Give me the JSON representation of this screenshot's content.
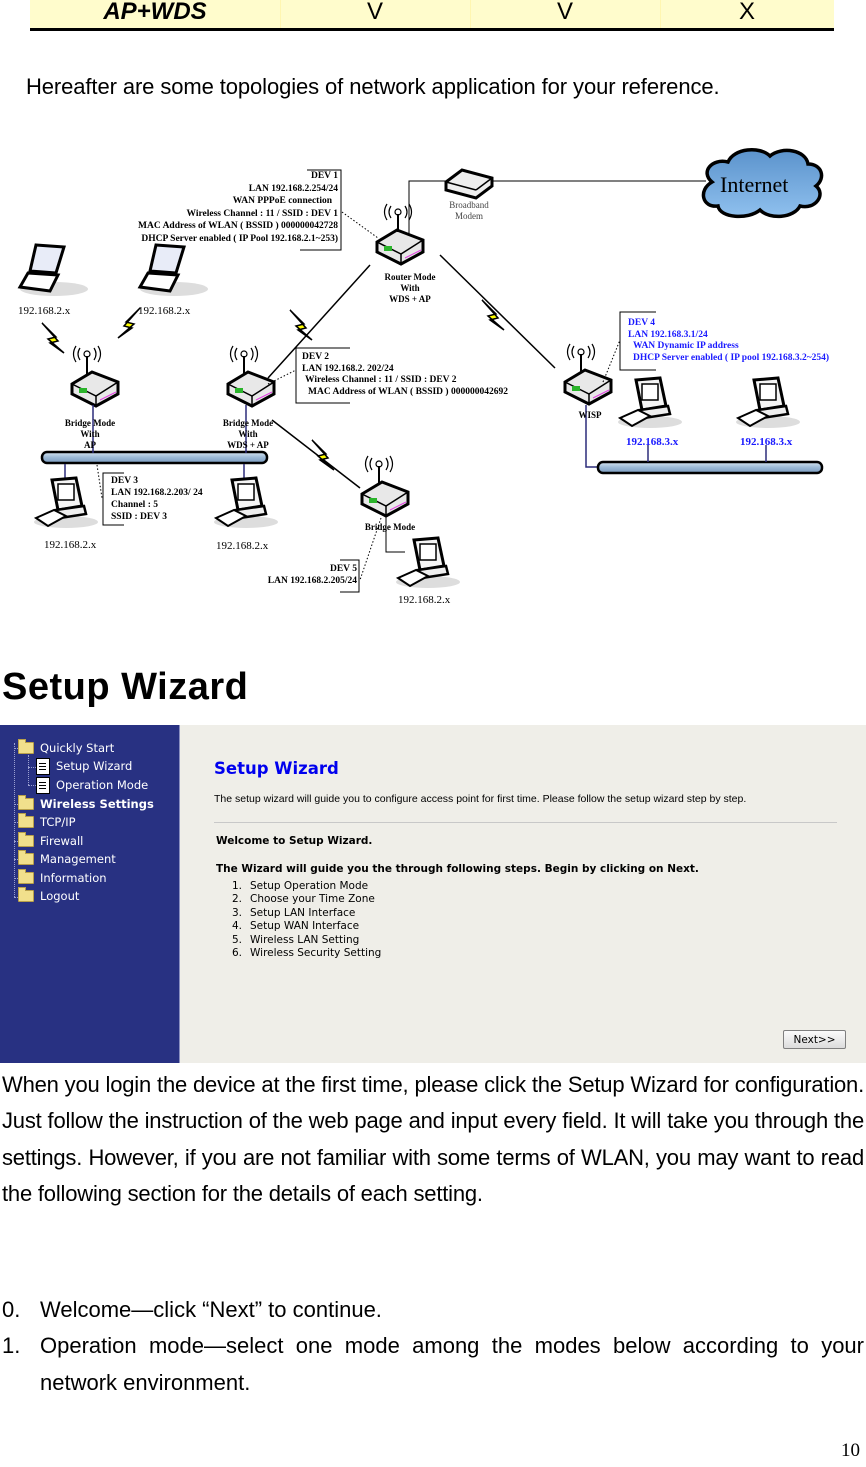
{
  "top_table": {
    "row_label": "AP+WDS",
    "values": [
      "V",
      "V",
      "X"
    ]
  },
  "intro_text": "Hereafter are some topologies of network application for your reference.",
  "diagram": {
    "internet_label": "Internet",
    "modem_label": [
      "Broadband",
      "Modem"
    ],
    "router_label": [
      "Router Mode",
      "With",
      "WDS  + AP"
    ],
    "bridge_ap_label": [
      "Bridge Mode",
      "With",
      "AP"
    ],
    "bridge_wds_label": [
      "Bridge Mode",
      "With",
      "WDS  + AP"
    ],
    "bridge_label": "Bridge Mode",
    "wisp_label": "WISP",
    "dev1": [
      "DEV 1",
      "LAN  192.168.2.254/24",
      "WAN PPPoE connection",
      "Wireless Channel   : 11 / SSID :  DEV 1",
      "MAC Address of WLAN   ( BSSID )   000000042728",
      "DHCP Server enabled   ( IP Pool  192.168.2.1~253)"
    ],
    "dev2": [
      "DEV 2",
      "LAN  192.168.2. 202/24",
      "Wireless Channel   : 11 / SSID :  DEV 2",
      "MAC Address of WLAN   ( BSSID )   000000042692"
    ],
    "dev3": [
      "DEV 3",
      "LAN 192.168.2.203/ 24",
      "Channel : 5",
      "SSID :  DEV 3"
    ],
    "dev4": [
      "DEV 4",
      "LAN  192.168.3.1/24",
      "WAN Dynamic IP address",
      "DHCP Server enabled   (  IP pool  192.168.3.2~254)"
    ],
    "dev5": [
      "DEV 5",
      "LAN  192.168.2.205/24"
    ],
    "ip_labels": {
      "laptop1": "192.168.2.x",
      "laptop2": "192.168.2.x",
      "pc_bridge_ap": "192.168.2.x",
      "pc_bridge_wds": "192.168.2.x",
      "pc_bridge": "192.168.2.x",
      "pc_wisp1": "192.168.3.x",
      "pc_wisp2": "192.168.3.x"
    }
  },
  "section_title": "Setup Wizard",
  "screenshot": {
    "sidebar": {
      "items": [
        {
          "label": "Quickly Start",
          "icon": "folder-open-icon"
        },
        {
          "label": "Setup Wizard",
          "icon": "document-icon"
        },
        {
          "label": "Operation Mode",
          "icon": "document-icon"
        },
        {
          "label": "Wireless Settings",
          "icon": "folder-icon"
        },
        {
          "label": "TCP/IP",
          "icon": "folder-icon"
        },
        {
          "label": "Firewall",
          "icon": "folder-icon"
        },
        {
          "label": "Management",
          "icon": "folder-icon"
        },
        {
          "label": "Information",
          "icon": "folder-icon"
        },
        {
          "label": "Logout",
          "icon": "folder-icon"
        }
      ]
    },
    "title": "Setup Wizard",
    "description": "The setup wizard will guide you to configure access point for first time. Please follow the setup wizard step by step.",
    "welcome": "Welcome to Setup Wizard.",
    "guide": "The Wizard will guide you the through following steps. Begin by clicking on Next.",
    "steps": [
      {
        "num": "1.",
        "label": "Setup Operation Mode"
      },
      {
        "num": "2.",
        "label": "Choose your Time Zone"
      },
      {
        "num": "3.",
        "label": "Setup LAN Interface"
      },
      {
        "num": "4.",
        "label": "Setup WAN Interface"
      },
      {
        "num": "5.",
        "label": "Wireless LAN Setting"
      },
      {
        "num": "6.",
        "label": "Wireless Security Setting"
      }
    ],
    "next_label": "Next>>",
    "colors": {
      "sidebar_bg": "#283182",
      "title_blue": "#0000ee",
      "content_bg": "#efeee8"
    }
  },
  "paragraph": "When you login the device at the first time, please click the Setup Wizard for configuration. Just follow the instruction of the web page and input every field. It will take you through the settings. However, if you are not familiar with some terms of WLAN, you may want to read the following section for the details of each setting.",
  "list": [
    {
      "num": "0.",
      "text": "Welcome—click “Next” to continue."
    },
    {
      "num": "1.",
      "text": "Operation mode—select one mode among the modes below according to your network environment."
    }
  ],
  "page_number": "10"
}
